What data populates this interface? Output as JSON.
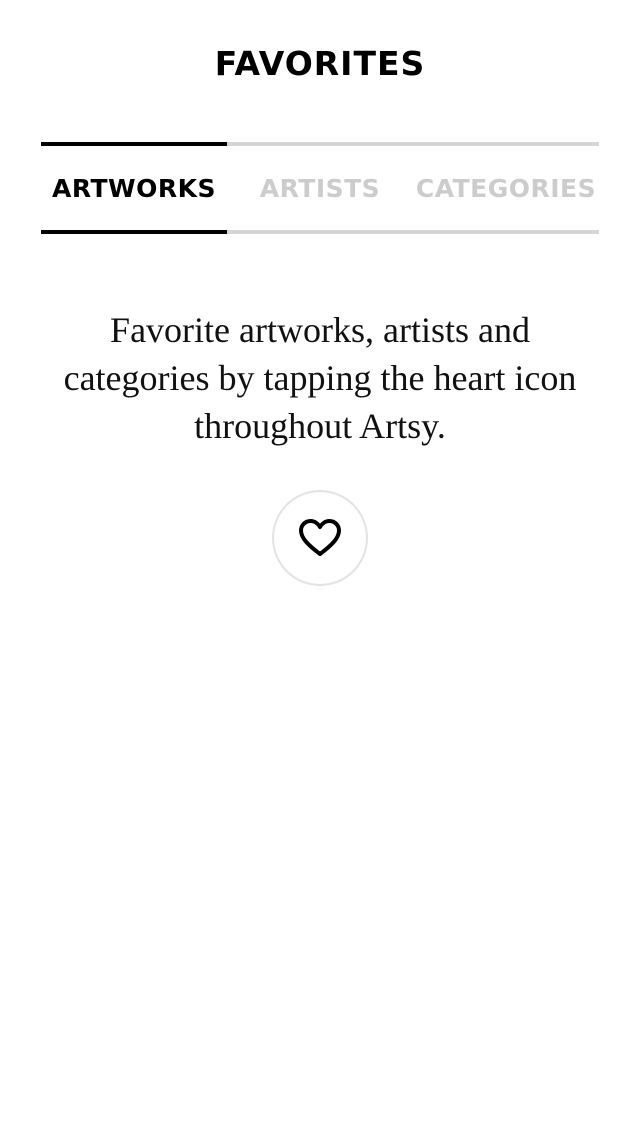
{
  "header": {
    "title": "FAVORITES"
  },
  "tabs": [
    {
      "label": "ARTWORKS",
      "active": true
    },
    {
      "label": "ARTISTS",
      "active": false
    },
    {
      "label": "CATEGORIES",
      "active": false
    }
  ],
  "empty_state": {
    "message": "Favorite artworks, artists and categories by tapping the heart icon throughout Artsy.",
    "icon": "heart-icon"
  },
  "colors": {
    "active_tab": "#000000",
    "inactive_tab": "#cccccc",
    "tab_rule": "#d6d6d6",
    "button_border": "#e3e3e3"
  }
}
